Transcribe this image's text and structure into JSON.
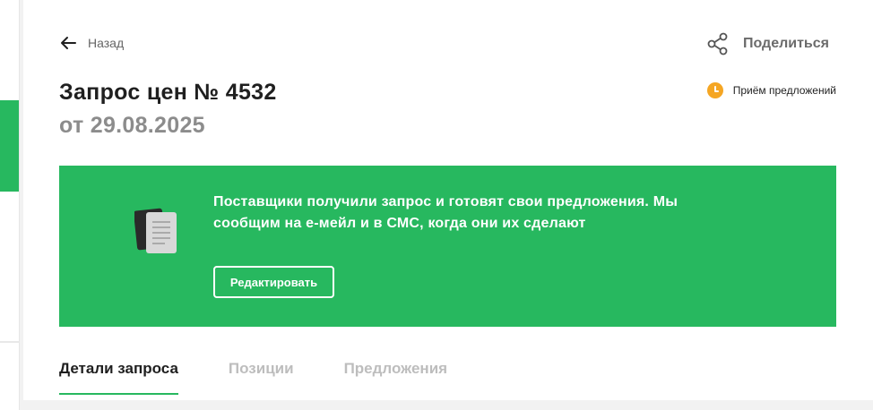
{
  "nav": {
    "back_label": "Назад"
  },
  "share": {
    "label": "Поделиться"
  },
  "status": {
    "label": "Приём предложений",
    "color": "#f5a623"
  },
  "request": {
    "title": "Запрос цен № 4532",
    "date": "от 29.08.2025"
  },
  "banner": {
    "message": "Поставщики получили запрос и готовят свои предложения. Мы сообщим на е-мейл и в СМС, когда они их сделают",
    "edit_label": "Редактировать",
    "color": "#27b85f"
  },
  "tabs": [
    {
      "label": "Детали запроса",
      "active": true
    },
    {
      "label": "Позиции",
      "active": false
    },
    {
      "label": "Предложения",
      "active": false
    }
  ]
}
